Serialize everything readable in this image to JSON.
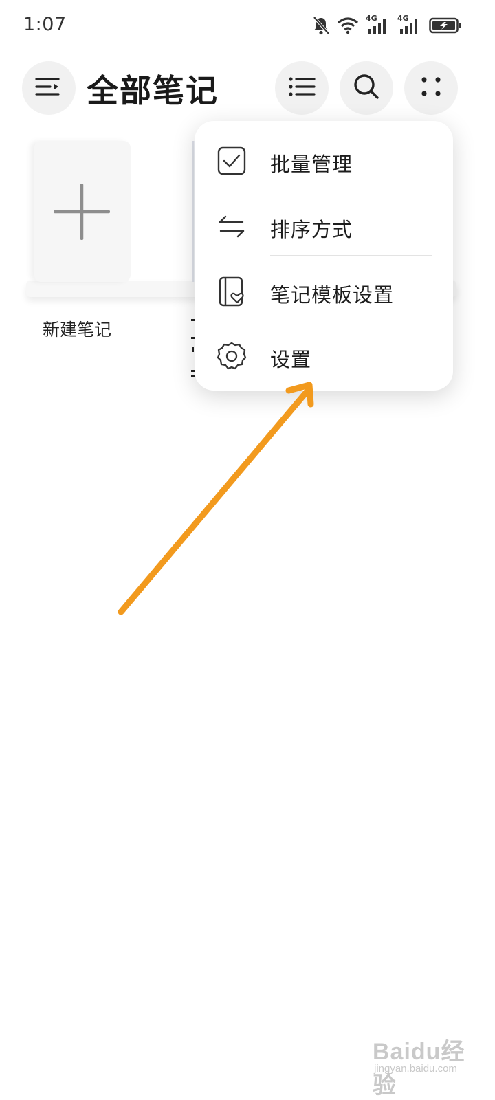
{
  "status_bar": {
    "time": "1:07",
    "network_1": "4G",
    "network_2": "4G",
    "icons": [
      "bell-muted-icon",
      "wifi-icon",
      "signal-icon",
      "signal-icon",
      "battery-charging-icon"
    ]
  },
  "header": {
    "title": "全部笔记",
    "menu_icon": "menu-icon",
    "list_icon": "list-view-icon",
    "search_icon": "search-icon",
    "more_icon": "more-dots-icon"
  },
  "notes": {
    "new_note_label": "新建笔记"
  },
  "popup_menu": {
    "items": [
      {
        "label": "批量管理",
        "icon": "checkbox-icon"
      },
      {
        "label": "排序方式",
        "icon": "sort-arrows-icon"
      },
      {
        "label": "笔记模板设置",
        "icon": "template-heart-icon"
      },
      {
        "label": "设置",
        "icon": "gear-icon"
      }
    ]
  },
  "annotation": {
    "arrow_color": "#f29a1e"
  },
  "watermark": {
    "brand": "Baidu经验",
    "url": "jingyan.baidu.com"
  },
  "colors": {
    "accent_arrow": "#f29a1e",
    "button_bg": "#f1f1f1",
    "text": "#1c1c1c"
  }
}
